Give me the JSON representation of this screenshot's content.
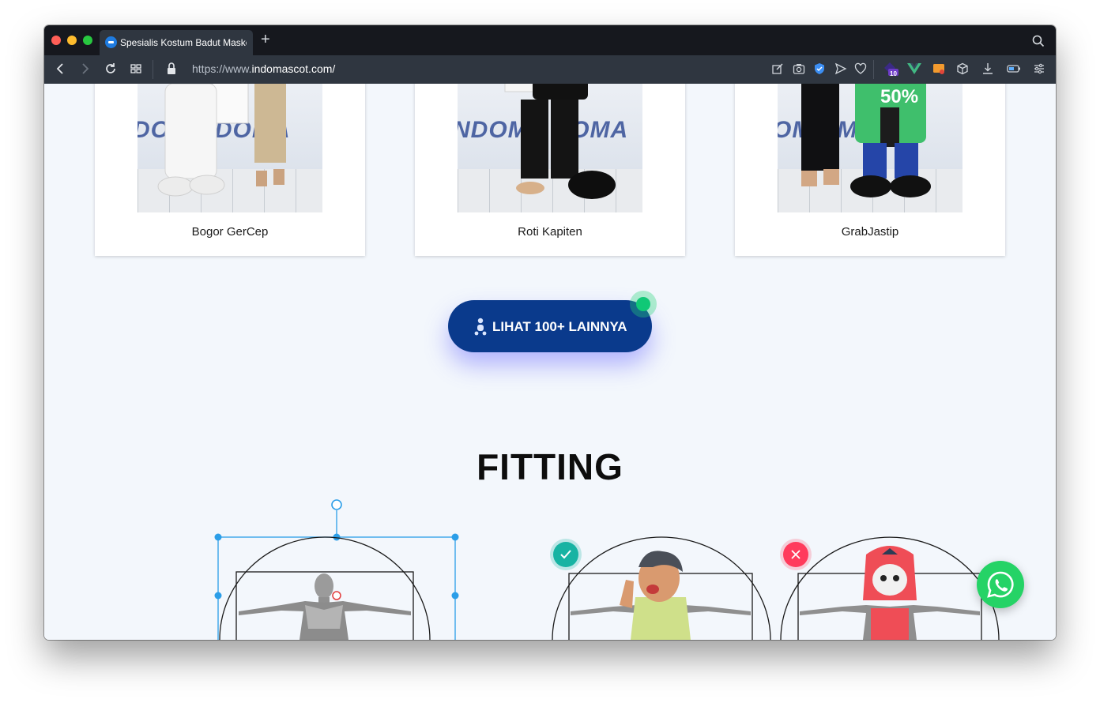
{
  "browser": {
    "tab_title": "Spesialis Kostum Badut Maskot",
    "new_tab_symbol": "+",
    "url_prefix": "https://www.",
    "url_domain": "indomascot.com/",
    "extension_badge": "10",
    "icons": [
      "close-dot",
      "minimize-dot",
      "maximize-dot",
      "search-icon",
      "back-icon",
      "forward-icon",
      "reload-icon",
      "tabs-grid-icon",
      "lock-icon",
      "edit-icon",
      "camera-icon",
      "shield-icon",
      "send-icon",
      "heart-icon",
      "extension-icon",
      "vue-icon",
      "extension-icon-2",
      "cube-icon",
      "download-icon",
      "battery-icon",
      "settings-icon"
    ],
    "colors": {
      "close": "#ff5f57",
      "minimize": "#febc2e",
      "maximize": "#28c840"
    }
  },
  "gallery": {
    "cards": [
      {
        "caption": "Bogor GerCep",
        "backdrop_text": "DOMA   DOMA"
      },
      {
        "caption": "Roti Kapiten",
        "backdrop_text": "NDOMA    DOMA"
      },
      {
        "caption": "GrabJastip",
        "backdrop_text": "OMA    MA"
      }
    ]
  },
  "cta": {
    "label": "LIHAT 100+ LAINNYA",
    "icon": "baby-icon",
    "color": "#0a3a8c"
  },
  "fitting": {
    "heading": "FITTING",
    "badges": [
      {
        "icon": "check-icon",
        "color": "#17b3a3"
      },
      {
        "icon": "close-icon",
        "color": "#ff3b5c"
      }
    ]
  },
  "whatsapp": {
    "icon": "whatsapp-icon",
    "color": "#25d366"
  }
}
